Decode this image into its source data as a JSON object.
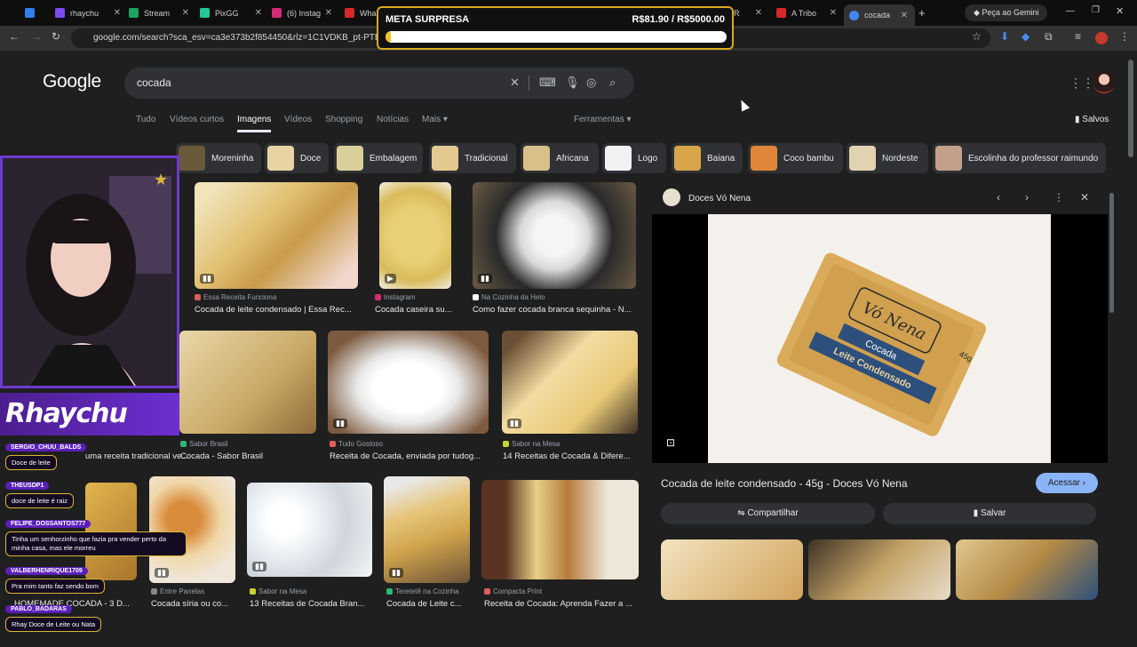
{
  "browser": {
    "tabs": [
      {
        "title": "",
        "color": "#2f80ed"
      },
      {
        "title": "rhaychu",
        "color": "#7a4cf0"
      },
      {
        "title": "Stream",
        "color": "#1aa260"
      },
      {
        "title": "PixGG",
        "color": "#23c79a"
      },
      {
        "title": "(6) Instag",
        "color": "#d62976"
      },
      {
        "title": "Wha",
        "color": "#d62828"
      },
      {
        "title": "R",
        "color": "#d62828"
      },
      {
        "title": "A Tribo",
        "color": "#d62828"
      },
      {
        "title": "cocada",
        "color": "#4285f4"
      }
    ],
    "gemini_label": "Peça ao Gemini",
    "url": "google.com/search?sca_esv=ca3e373b2f854450&rlz=1C1VDKB_pt-PTBR1166 ... FVGaQeaqnsRPl5sOMG32Ksz3p-O3lbOMn-3Vf9JCibNb6vuiU..."
  },
  "overlay_meta": {
    "title": "META SURPRESA",
    "amount": "R$81.90 / R$5000.00",
    "progress_fraction": 0.016
  },
  "google": {
    "logo": "Google",
    "query": "cocada",
    "nav": [
      "Tudo",
      "Vídeos curtos",
      "Imagens",
      "Vídeos",
      "Shopping",
      "Notícias",
      "Mais ▾"
    ],
    "tools": "Ferramentas ▾",
    "saved": "Salvos",
    "chips": [
      "Moreninha",
      "Doce",
      "Embalagem",
      "Tradicional",
      "Africana",
      "Logo",
      "Baiana",
      "Coco bambu",
      "Nordeste",
      "Escolinha do professor raimundo"
    ]
  },
  "results": [
    {
      "source": "Essa Receita Funciona",
      "caption": "Cocada de leite condensado | Essa Rec...",
      "color": "#d95c5c"
    },
    {
      "source": "Instagram",
      "caption": "Cocada caseira su...",
      "color": "#d62976"
    },
    {
      "source": "Na Cozinha da Helo",
      "caption": "Como fazer cocada branca sequinha - N...",
      "color": "#ffffff"
    },
    {
      "source": "Sabor Brasil",
      "caption": "Cocada - Sabor Brasil",
      "color": "#2bb673"
    },
    {
      "source": "Tudo Gostoso",
      "caption": "Receita de Cocada, enviada por tudog...",
      "color": "#e25c5c"
    },
    {
      "source": "Sabor na Mesa",
      "caption": "14 Receitas de Cocada & Difere...",
      "color": "#c8d52a"
    },
    {
      "source": "",
      "caption": "uma receita tradicional ve...",
      "color": "#888888"
    },
    {
      "source": "Entre Panelas",
      "caption": "Cocada síria ou co...",
      "color": "#888888"
    },
    {
      "source": "Sabor na Mesa",
      "caption": "13 Receitas de Cocada Bran...",
      "color": "#c8d52a"
    },
    {
      "source": "Teretetê na Cozinha",
      "caption": "Cocada de Leite c...",
      "color": "#2bb673"
    },
    {
      "source": "Compacta Print",
      "caption": "Receita de Cocada: Aprenda Fazer a ...",
      "color": "#e25c5c"
    },
    {
      "source": "",
      "caption": "HOMEMADE COCADA - 3 D...",
      "color": "#888888"
    }
  ],
  "panel": {
    "site": "Doces Vó Nena",
    "title": "Cocada de leite condensado - 45g - Doces Vó Nena",
    "acessar": "Acessar ›",
    "share": "Compartilhar",
    "save": "Salvar",
    "package_brand": "Vó Nena",
    "package_label1": "Cocada",
    "package_label2": "Leite Condensado",
    "package_weight": "45g"
  },
  "stream": {
    "brand": "Rhaychu",
    "chat": [
      {
        "user": "SERGIO_CHUU_BALDS",
        "msg": "Doce de leite"
      },
      {
        "user": "THEUSDP1",
        "msg": "doce de leite é raiz"
      },
      {
        "user": "FELIPE_DOSSANTOS777",
        "msg": "Tinha um senhorzinho que fazia pra vender perto da minha casa, mas ele morreu"
      },
      {
        "user": "VALBERHENRIQUE1709",
        "msg": "Pra mim tanto faz sendo bom"
      },
      {
        "user": "PABLO_BADARAS",
        "msg": "Rhay Doce de Leite ou Nata"
      }
    ]
  }
}
